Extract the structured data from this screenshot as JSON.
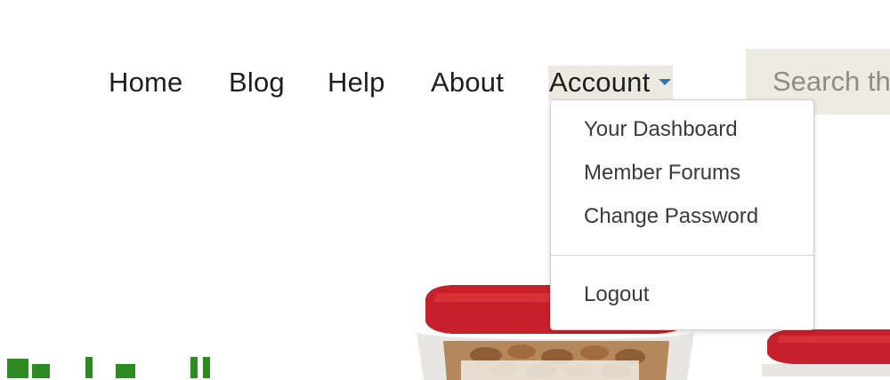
{
  "nav": {
    "items": [
      {
        "label": "Home"
      },
      {
        "label": "Blog"
      },
      {
        "label": "Help"
      },
      {
        "label": "About"
      }
    ],
    "account": {
      "label": "Account"
    }
  },
  "search": {
    "placeholder": "Search th"
  },
  "account_menu": {
    "items": [
      {
        "label": "Your Dashboard"
      },
      {
        "label": "Member Forums"
      },
      {
        "label": "Change Password"
      }
    ],
    "logout_label": "Logout"
  },
  "colors": {
    "accent": "#2b7bb0",
    "account_highlight": "#ece9e2",
    "search_bg": "#ecebe3",
    "container_lid_red": "#c8202a",
    "headline_green": "#2e8b21"
  }
}
